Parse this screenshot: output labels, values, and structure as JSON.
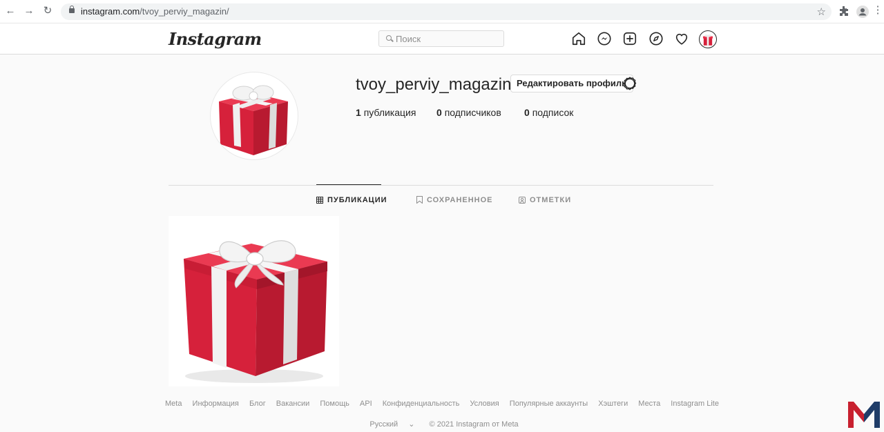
{
  "browser": {
    "url_domain": "instagram.com",
    "url_path": "/tvoy_perviy_magazin/"
  },
  "header": {
    "logo_text": "Instagram",
    "search_placeholder": "Поиск"
  },
  "profile": {
    "username": "tvoy_perviy_magazin",
    "edit_label": "Редактировать профиль",
    "stats": [
      {
        "count": "1",
        "label": "публикация"
      },
      {
        "count": "0",
        "label": "подписчиков"
      },
      {
        "count": "0",
        "label": "подписок"
      }
    ]
  },
  "tabs": [
    {
      "label": "ПУБЛИКАЦИИ",
      "icon": "grid-icon"
    },
    {
      "label": "СОХРАНЕННОЕ",
      "icon": "bookmark-icon"
    },
    {
      "label": "ОТМЕТКИ",
      "icon": "tag-icon"
    }
  ],
  "footer": {
    "links": [
      "Meta",
      "Информация",
      "Блог",
      "Вакансии",
      "Помощь",
      "API",
      "Конфиденциальность",
      "Условия",
      "Популярные аккаунты",
      "Хэштеги",
      "Места",
      "Instagram Lite"
    ],
    "language": "Русский",
    "copyright": "© 2021 Instagram от Meta"
  },
  "colors": {
    "gift_red": "#d6213b",
    "ribbon": "#f2f2f2",
    "corner_logo_red": "#c8202f",
    "corner_logo_blue": "#1f3c68"
  }
}
